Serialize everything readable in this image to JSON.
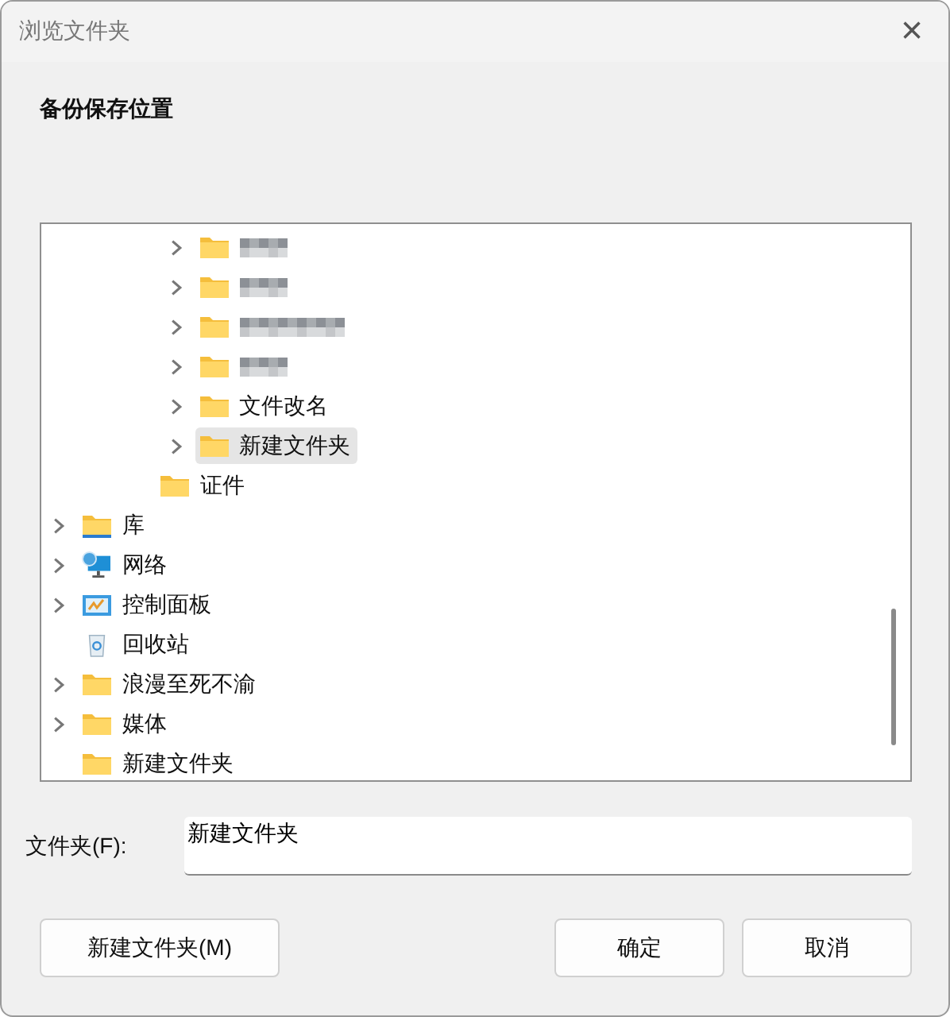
{
  "window": {
    "title": "浏览文件夹",
    "close": "×"
  },
  "description": "备份保存位置",
  "tree": {
    "items": [
      {
        "children": [
          {
            "children": [
              {
                "children": [
                  {
                    "kind": "blurred",
                    "expandable": true,
                    "selected": false
                  },
                  {
                    "kind": "blurred",
                    "expandable": true,
                    "selected": false
                  },
                  {
                    "kind": "blurred",
                    "expandable": true,
                    "selected": false
                  },
                  {
                    "kind": "blurred",
                    "expandable": true,
                    "selected": false
                  },
                  {
                    "kind": "folder",
                    "label": "文件改名",
                    "expandable": true,
                    "selected": false
                  },
                  {
                    "kind": "folder",
                    "label": "新建文件夹",
                    "expandable": true,
                    "selected": true
                  }
                ]
              },
              {
                "kind": "folder",
                "label": "证件",
                "expandable": false,
                "selected": false
              }
            ]
          }
        ]
      },
      {
        "kind": "library",
        "label": "库",
        "expandable": true,
        "selected": false
      },
      {
        "kind": "network",
        "label": "网络",
        "expandable": true,
        "selected": false
      },
      {
        "kind": "control-panel",
        "label": "控制面板",
        "expandable": true,
        "selected": false
      },
      {
        "kind": "recycle-bin",
        "label": "回收站",
        "expandable": false,
        "selected": false
      },
      {
        "kind": "folder",
        "label": "浪漫至死不渝",
        "expandable": true,
        "selected": false
      },
      {
        "kind": "folder",
        "label": "媒体",
        "expandable": true,
        "selected": false
      },
      {
        "kind": "folder",
        "label": "新建文件夹",
        "expandable": false,
        "selected": false
      }
    ]
  },
  "folder_field": {
    "label": "文件夹(F):",
    "value": "新建文件夹"
  },
  "buttons": {
    "new_folder": "新建文件夹(M)",
    "ok": "确定",
    "cancel": "取消"
  }
}
